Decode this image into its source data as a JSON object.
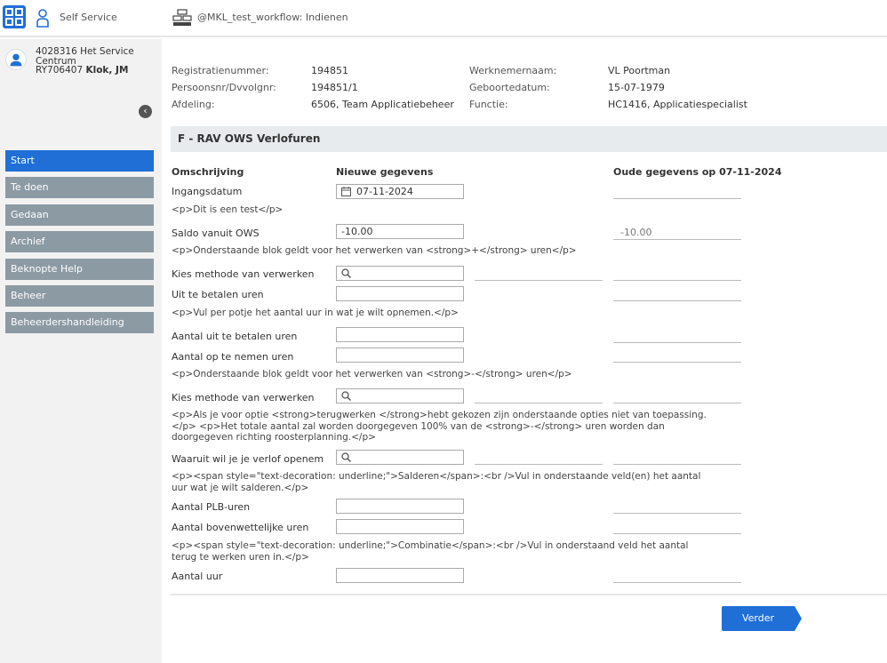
{
  "topbar": {
    "app_name": "Self Service",
    "workflow_title": "@MKL_test_workflow: Indienen"
  },
  "sidebar": {
    "user_line1": "4028316 Het Service",
    "user_line2": "Centrum",
    "user_line3_prefix": "RY706407 ",
    "user_line3_name": "Klok, JM",
    "items": [
      {
        "label": "Start"
      },
      {
        "label": "Te doen"
      },
      {
        "label": "Gedaan"
      },
      {
        "label": "Archief"
      },
      {
        "label": "Beknopte Help"
      },
      {
        "label": "Beheer"
      },
      {
        "label": "Beheerdershandleiding"
      }
    ]
  },
  "header": {
    "reg_label": "Registratienummer:",
    "reg_value": "194851",
    "pers_label": "Persoonsnr/Dvvolgnr:",
    "pers_value": "194851/1",
    "afd_label": "Afdeling:",
    "afd_value": "6506, Team Applicatiebeheer",
    "naam_label": "Werknemernaam:",
    "naam_value": "VL Poortman",
    "geb_label": "Geboortedatum:",
    "geb_value": "15-07-1979",
    "func_label": "Functie:",
    "func_value": "HC1416, Applicatiespecialist"
  },
  "form": {
    "section_title": "F - RAV OWS Verlofuren",
    "col_omschrijving": "Omschrijving",
    "col_nieuw": "Nieuwe gegevens",
    "col_oud": "Oude gegevens op 07-11-2024",
    "ingangsdatum_label": "Ingangsdatum",
    "ingangsdatum_value": "07-11-2024",
    "note1": "<p>Dit is een test</p>",
    "saldo_label": "Saldo vanuit OWS",
    "saldo_value": "-10.00",
    "saldo_old": "-10.00",
    "note2": "<p>Onderstaande blok geldt voor het verwerken van <strong>+</strong> uren</p>",
    "methode1_label": "Kies methode van verwerken",
    "uitbetalen_label": "Uit te betalen uren",
    "note3": "<p>Vul per potje het aantal uur in wat je wilt opnemen.</p>",
    "aantal_uitbetalen_label": "Aantal uit te betalen uren",
    "aantal_opnemen_label": "Aantal op te nemen uren",
    "note4": "<p>Onderstaande blok geldt voor het verwerken van <strong>-</strong> uren</p>",
    "methode2_label": "Kies methode van verwerken",
    "note5": "<p>Als je voor optie <strong>terugwerken </strong>hebt gekozen zijn onderstaande opties niet van toepassing.</p> <p>Het totale aantal zal worden doorgegeven 100% van de <strong>-</strong> uren worden dan doorgegeven richting roosterplanning.</p>",
    "verlof_label": "Waaruit wil je je verlof openem",
    "note6": "<p><span style=\"text-decoration: underline;\">Salderen</span>:<br />Vul in onderstaande veld(en) het aantal uur wat je wilt salderen.</p>",
    "plb_label": "Aantal PLB-uren",
    "bovenwettelijk_label": "Aantal bovenwettelijke uren",
    "note7": "<p><span style=\"text-decoration: underline;\">Combinatie</span>:<br />Vul in onderstaand veld het aantal terug te werken uren in.</p>",
    "aantal_uur_label": "Aantal uur",
    "verder_label": "Verder"
  },
  "colors": {
    "accent": "#1f6fd6",
    "nav": "#8c9aa4"
  }
}
